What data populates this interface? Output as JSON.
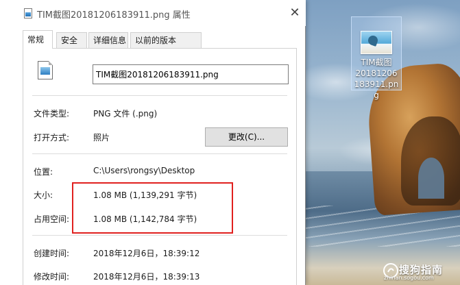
{
  "dialog": {
    "title": "TIM截图20181206183911.png 属性",
    "close_glyph": "✕",
    "tabs": [
      {
        "label": "常规",
        "active": true
      },
      {
        "label": "安全",
        "active": false
      },
      {
        "label": "详细信息",
        "active": false
      },
      {
        "label": "以前的版本",
        "active": false
      }
    ],
    "file_name": "TIM截图20181206183911.png",
    "fields": {
      "type_label": "文件类型:",
      "type_value": "PNG 文件 (.png)",
      "open_with_label": "打开方式:",
      "open_with_value": "照片",
      "change_button": "更改(C)...",
      "location_label": "位置:",
      "location_value": "C:\\Users\\rongsy\\Desktop",
      "size_label": "大小:",
      "size_value": "1.08 MB (1,139,291 字节)",
      "disk_size_label": "占用空间:",
      "disk_size_value": "1.08 MB (1,142,784 字节)",
      "created_label": "创建时间:",
      "created_value": "2018年12月6日，18:39:12",
      "modified_label": "修改时间:",
      "modified_value": "2018年12月6日，18:39:13"
    },
    "highlight_color": "#e0201e"
  },
  "desktop": {
    "icon_label": "TIM截图20181206183911.png",
    "icon_label_wrapped": "TIM截图\n20181206\n183911.png",
    "watermark_text": "搜狗指南",
    "watermark_url": "zhinan.sogou.com"
  }
}
